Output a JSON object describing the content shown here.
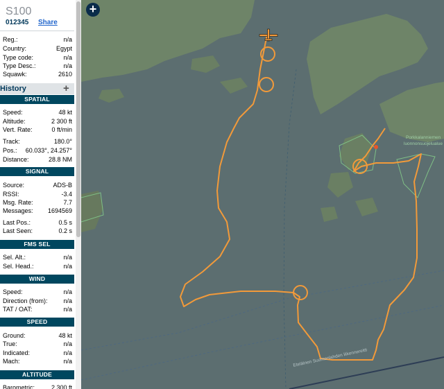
{
  "aircraft": {
    "callsign": "S100",
    "hex": "012345",
    "share_label": "Share"
  },
  "info": {
    "reg": {
      "label": "Reg.:",
      "value": "n/a"
    },
    "country": {
      "label": "Country:",
      "value": "Egypt"
    },
    "type_code": {
      "label": "Type code:",
      "value": "n/a"
    },
    "type_desc": {
      "label": "Type Desc.:",
      "value": "n/a"
    },
    "squawk": {
      "label": "Squawk:",
      "value": "2610"
    }
  },
  "history_label": "History",
  "history_plus": "+",
  "spatial": {
    "header": "SPATIAL",
    "speed": {
      "label": "Speed:",
      "value": "48 kt"
    },
    "altitude": {
      "label": "Altitude:",
      "value": "2 300 ft"
    },
    "vert_rate": {
      "label": "Vert. Rate:",
      "value": "0 ft/min"
    },
    "track": {
      "label": "Track:",
      "value": "180.0°"
    },
    "pos": {
      "label": "Pos.:",
      "value": "60.033°, 24.257°"
    },
    "distance": {
      "label": "Distance:",
      "value": "28.8 NM"
    }
  },
  "signal": {
    "header": "SIGNAL",
    "source": {
      "label": "Source:",
      "value": "ADS-B"
    },
    "rssi": {
      "label": "RSSI:",
      "value": "-3.4"
    },
    "msg_rate": {
      "label": "Msg. Rate:",
      "value": "7.7"
    },
    "messages": {
      "label": "Messages:",
      "value": "1694569"
    },
    "last_pos": {
      "label": "Last Pos.:",
      "value": "0.5 s"
    },
    "last_seen": {
      "label": "Last Seen:",
      "value": "0.2 s"
    }
  },
  "fms_sel": {
    "header": "FMS SEL",
    "sel_alt": {
      "label": "Sel. Alt.:",
      "value": "n/a"
    },
    "sel_head": {
      "label": "Sel. Head.:",
      "value": "n/a"
    }
  },
  "wind": {
    "header": "WIND",
    "speed": {
      "label": "Speed:",
      "value": "n/a"
    },
    "direction": {
      "label": "Direction (from):",
      "value": "n/a"
    },
    "tat_oat": {
      "label": "TAT / OAT:",
      "value": "n/a"
    }
  },
  "speed": {
    "header": "SPEED",
    "ground": {
      "label": "Ground:",
      "value": "48 kt"
    },
    "true": {
      "label": "True:",
      "value": "n/a"
    },
    "indicated": {
      "label": "Indicated:",
      "value": "n/a"
    },
    "mach": {
      "label": "Mach:",
      "value": "n/a"
    }
  },
  "altitude": {
    "header": "ALTITUDE",
    "barometric": {
      "label": "Barometric:",
      "value": "2 300 ft"
    }
  },
  "map": {
    "zoom_in": "+",
    "place_town": "Porkkalanniemen",
    "place_park": "luonnonsuojelualue",
    "route_label": "Eteläinen Suomenlahden liikennereitti"
  },
  "colors": {
    "panel_header": "#00475f",
    "track": "#f29a3a",
    "water": "#5c6e70",
    "land": "#6e8468",
    "link": "#2266cc"
  },
  "icons": [
    "zoom-in-icon",
    "aircraft-icon",
    "plus-icon"
  ]
}
